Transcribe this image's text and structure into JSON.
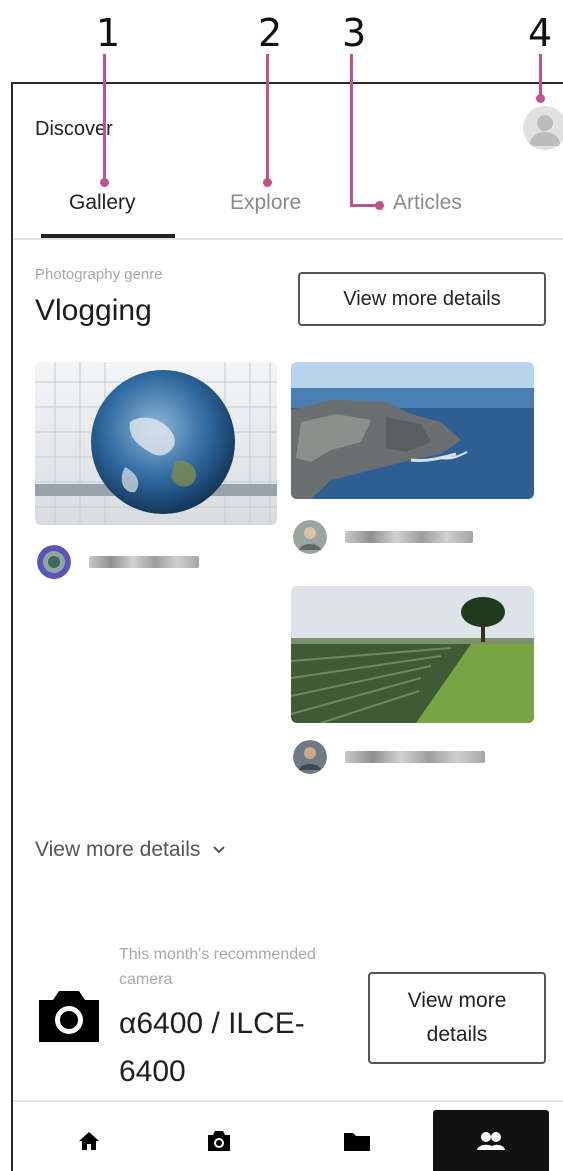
{
  "callouts": [
    "1",
    "2",
    "3",
    "4"
  ],
  "header": {
    "title": "Discover"
  },
  "tabs": [
    {
      "label": "Gallery",
      "active": true
    },
    {
      "label": "Explore",
      "active": false
    },
    {
      "label": "Articles",
      "active": false
    }
  ],
  "genre": {
    "caption": "Photography genre",
    "name": "Vlogging",
    "details_button": "View more details"
  },
  "gallery": {
    "items": [
      {
        "photo": "globe-sculpture-photo",
        "user": ""
      },
      {
        "photo": "coastal-cliffs-photo",
        "user": ""
      },
      {
        "photo": "farm-field-tree-photo",
        "user": ""
      }
    ]
  },
  "view_more_link": "View more details",
  "recommended": {
    "caption": "This month's recommended camera",
    "camera_name": "α6400 / ILCE-6400",
    "details_button": "View more details"
  },
  "bottom_nav": [
    {
      "icon": "home-icon",
      "active": false
    },
    {
      "icon": "camera-icon",
      "active": false
    },
    {
      "icon": "folder-icon",
      "active": false
    },
    {
      "icon": "people-icon",
      "active": true
    }
  ],
  "colors": {
    "callout": "#c2528b",
    "text": "#1f1f1f",
    "muted": "#a7a7a7",
    "nav_active": "#111111"
  }
}
